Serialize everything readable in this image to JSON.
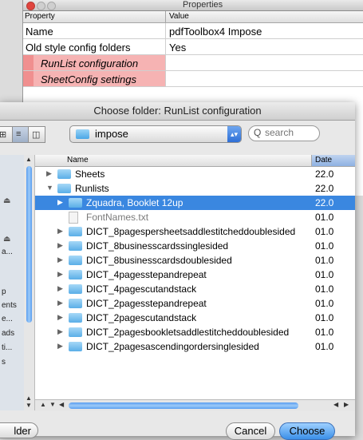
{
  "props_window": {
    "title": "Properties",
    "col_property": "Property",
    "col_value": "Value",
    "rows": [
      {
        "key": "Name",
        "value": "pdfToolbox4 Impose"
      },
      {
        "key": "Old style config folders",
        "value": "Yes"
      },
      {
        "key": "RunList configuration",
        "value": ""
      },
      {
        "key": "SheetConfig settings",
        "value": ""
      }
    ],
    "ellipsis": "..."
  },
  "dialog": {
    "title": "Choose folder: RunList configuration",
    "view_icons": "⊞",
    "view_list": "≡",
    "view_columns": "◫",
    "folder_popup": "impose",
    "popup_arrow": "▴▾",
    "search_placeholder": "search",
    "search_icon": "Q",
    "header_name": "Name",
    "header_date": "Date",
    "sidebar_items": [
      "a...",
      "p",
      "ents",
      "e...",
      "ads",
      "ti...",
      "s"
    ],
    "sidebar_eject": "⏏",
    "files": [
      {
        "name": "Sheets",
        "date": "22.0",
        "toggle": "▶"
      },
      {
        "name": "Runlists",
        "date": "22.0",
        "toggle": "▼"
      },
      {
        "name": "Zquadra, Booklet 12up",
        "date": "22.0",
        "toggle": "▶"
      },
      {
        "name": "FontNames.txt",
        "date": "01.0",
        "toggle": ""
      },
      {
        "name": "DICT_8pagespersheetsaddlestitcheddoublesided",
        "date": "01.0",
        "toggle": "▶"
      },
      {
        "name": "DICT_8businesscardssinglesided",
        "date": "01.0",
        "toggle": "▶"
      },
      {
        "name": "DICT_8businesscardsdoublesided",
        "date": "01.0",
        "toggle": "▶"
      },
      {
        "name": "DICT_4pagesstepandrepeat",
        "date": "01.0",
        "toggle": "▶"
      },
      {
        "name": "DICT_4pagescutandstack",
        "date": "01.0",
        "toggle": "▶"
      },
      {
        "name": "DICT_2pagesstepandrepeat",
        "date": "01.0",
        "toggle": "▶"
      },
      {
        "name": "DICT_2pagescutandstack",
        "date": "01.0",
        "toggle": "▶"
      },
      {
        "name": "DICT_2pagesbookletsaddlestitcheddoublesided",
        "date": "01.0",
        "toggle": "▶"
      },
      {
        "name": "DICT_2pagesascendingordersinglesided",
        "date": "01.0",
        "toggle": "▶"
      }
    ],
    "new_folder_label": "lder",
    "cancel_label": "Cancel",
    "choose_label": "Choose",
    "scroll_up": "▲",
    "scroll_down": "▼",
    "scroll_left": "◀",
    "scroll_right": "▶"
  },
  "colors": {
    "selection": "#3a87e0",
    "pink_row": "#f6b3b3",
    "accent_button": "#3b8fe8"
  }
}
